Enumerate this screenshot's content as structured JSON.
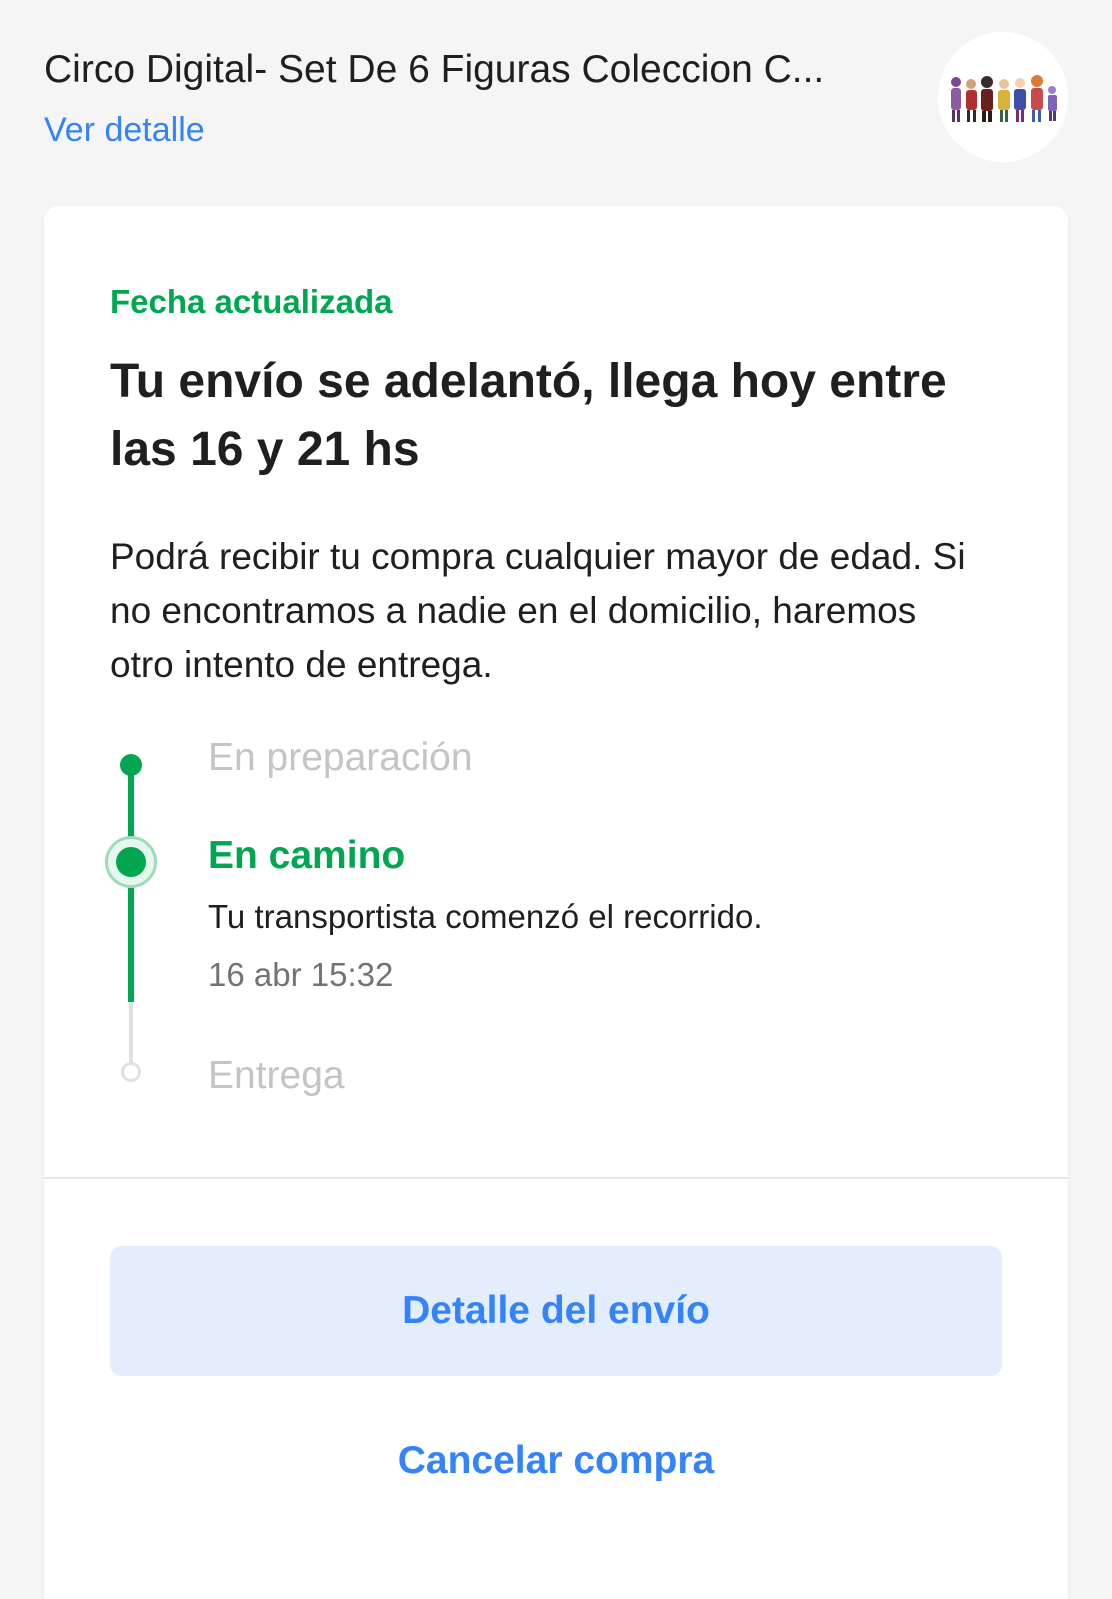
{
  "header": {
    "product_title": "Circo Digital- Set De 6 Figuras Coleccion C...",
    "detail_link": "Ver detalle",
    "thumbnail_icon": "product-figures-image"
  },
  "shipment": {
    "status_tag": "Fecha actualizada",
    "headline": "Tu envío se adelantó, llega hoy entre las 16 y 21 hs",
    "description": "Podrá recibir tu compra cualquier mayor de edad. Si no encontramos a nadie en el domicilio, haremos otro intento de entrega.",
    "steps": [
      {
        "label": "En preparación",
        "state": "done"
      },
      {
        "label": "En camino",
        "state": "current",
        "detail": "Tu transportista comenzó el recorrido.",
        "time": "16 abr 15:32"
      },
      {
        "label": "Entrega",
        "state": "pending"
      }
    ]
  },
  "actions": {
    "primary_label": "Detalle del envío",
    "secondary_label": "Cancelar compra"
  },
  "colors": {
    "accent_green": "#00a650",
    "link_blue": "#3483fa",
    "button_bg": "#e3edfb",
    "page_bg": "#f5f5f5"
  }
}
